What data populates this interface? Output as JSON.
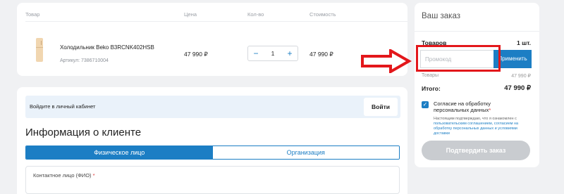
{
  "cart": {
    "headers": {
      "product": "Товар",
      "price": "Цена",
      "qty": "Кол-во",
      "cost": "Стоимость"
    },
    "item": {
      "name": "Холодильник Beko B3RCNK402HSB",
      "sku": "Артикул: 7386710004",
      "price": "47 990 ₽",
      "qty": "1",
      "cost": "47 990 ₽",
      "minus": "−",
      "plus": "+"
    }
  },
  "client": {
    "login_text": "Войдите в личный кабинет",
    "login_button": "Войти",
    "title": "Информация о клиенте",
    "tabs": [
      "Физическое лицо",
      "Организация"
    ],
    "contact_label": "Контактное лицо (ФИО)",
    "required_mark": "*"
  },
  "order": {
    "title": "Ваш заказ",
    "items_label": "Товаров",
    "items_value": "1 шт.",
    "promo_placeholder": "Промокод",
    "promo_button": "Применить",
    "goods_label": "Товары",
    "goods_value": "47 990 ₽",
    "total_label": "Итого:",
    "total_value": "47 990 ₽",
    "consent_text": "Согласие на обработку персональных данных",
    "fine_print": "Настоящим подтверждаю, что я ознакомлен с",
    "fine_link": "пользовательским соглашением, согласием на обработку персональных данных и условиями доставки",
    "confirm_button": "Подтвердить заказ"
  },
  "colors": {
    "accent": "#1c7ec4",
    "annotation": "#e3171b",
    "disabled": "#c9ccd0"
  }
}
